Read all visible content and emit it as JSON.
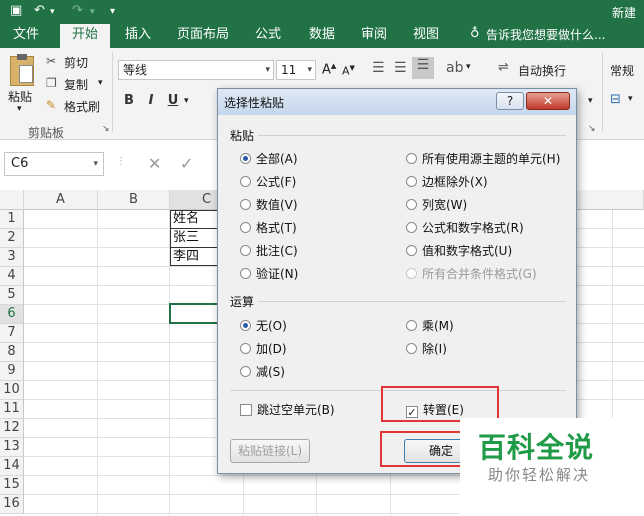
{
  "titlebar": {
    "right_title": "新建"
  },
  "tabs": [
    "文件",
    "开始",
    "插入",
    "页面布局",
    "公式",
    "数据",
    "审阅",
    "视图"
  ],
  "tell_me": "告诉我您想要做什么...",
  "ribbon": {
    "paste": "粘贴",
    "cut": "剪切",
    "copy": "复制",
    "format_painter": "格式刷",
    "clipboard_group": "剪贴板",
    "font_name": "等线",
    "font_size": "11",
    "bold": "B",
    "italic": "I",
    "underline": "U",
    "wrap_text": "自动换行",
    "number_format": "常规"
  },
  "name_box": "C6",
  "columns": [
    "A",
    "B",
    "C"
  ],
  "rows": [
    "1",
    "2",
    "3",
    "4",
    "5",
    "6",
    "7",
    "8",
    "9",
    "10",
    "11",
    "12",
    "13",
    "14",
    "15",
    "16"
  ],
  "cells": {
    "c1": "姓名",
    "c2": "张三",
    "c3": "李四"
  },
  "dialog": {
    "title": "选择性粘贴",
    "help": "?",
    "close": "✕",
    "paste_section": "粘贴",
    "paste_options_left": [
      "全部(A)",
      "公式(F)",
      "数值(V)",
      "格式(T)",
      "批注(C)",
      "验证(N)"
    ],
    "paste_options_right": [
      "所有使用源主题的单元(H)",
      "边框除外(X)",
      "列宽(W)",
      "公式和数字格式(R)",
      "值和数字格式(U)",
      "所有合并条件格式(G)"
    ],
    "operation_section": "运算",
    "operation_left": [
      "无(O)",
      "加(D)",
      "减(S)"
    ],
    "operation_right": [
      "乘(M)",
      "除(I)"
    ],
    "skip_blanks": "跳过空单元(B)",
    "transpose": "转置(E)",
    "transpose_checkmark": "✓",
    "paste_link": "粘贴链接(L)",
    "ok": "确定"
  },
  "watermark": {
    "big": "百科全说",
    "small": "助你轻松解决"
  }
}
